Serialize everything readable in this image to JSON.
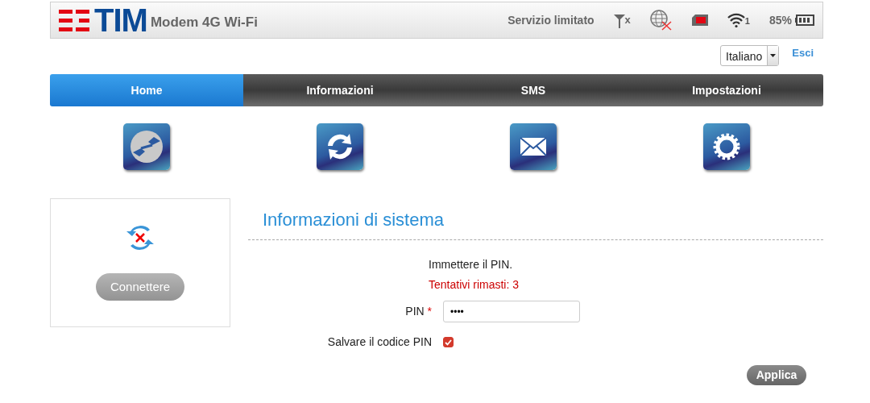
{
  "header": {
    "logo": "TIM",
    "product": "Modem 4G Wi-Fi",
    "service_status": "Servizio limitato",
    "signal_mark": "x",
    "wifi_clients": "1",
    "battery": "85%"
  },
  "language": {
    "value": "Italiano"
  },
  "logout": "Esci",
  "tabs": [
    {
      "label": "Home",
      "selected": true
    },
    {
      "label": "Informazioni",
      "selected": false
    },
    {
      "label": "SMS",
      "selected": false
    },
    {
      "label": "Impostazioni",
      "selected": false
    }
  ],
  "shortcuts": [
    {
      "kind": "connection"
    },
    {
      "kind": "refresh"
    },
    {
      "kind": "mail"
    },
    {
      "kind": "settings"
    }
  ],
  "connection_panel": {
    "connected": false,
    "button": {
      "label": "Connettere",
      "disabled": true
    }
  },
  "section_title": "Informazioni di sistema",
  "pin_form": {
    "prompt": "Immettere il PIN.",
    "attempts": "Tentativi rimasti: 3",
    "pin_label": "PIN",
    "required_mark": "*",
    "pin_value": "••••",
    "save_label": "Salvare il codice PIN",
    "save_checked": true,
    "apply": "Applica"
  }
}
